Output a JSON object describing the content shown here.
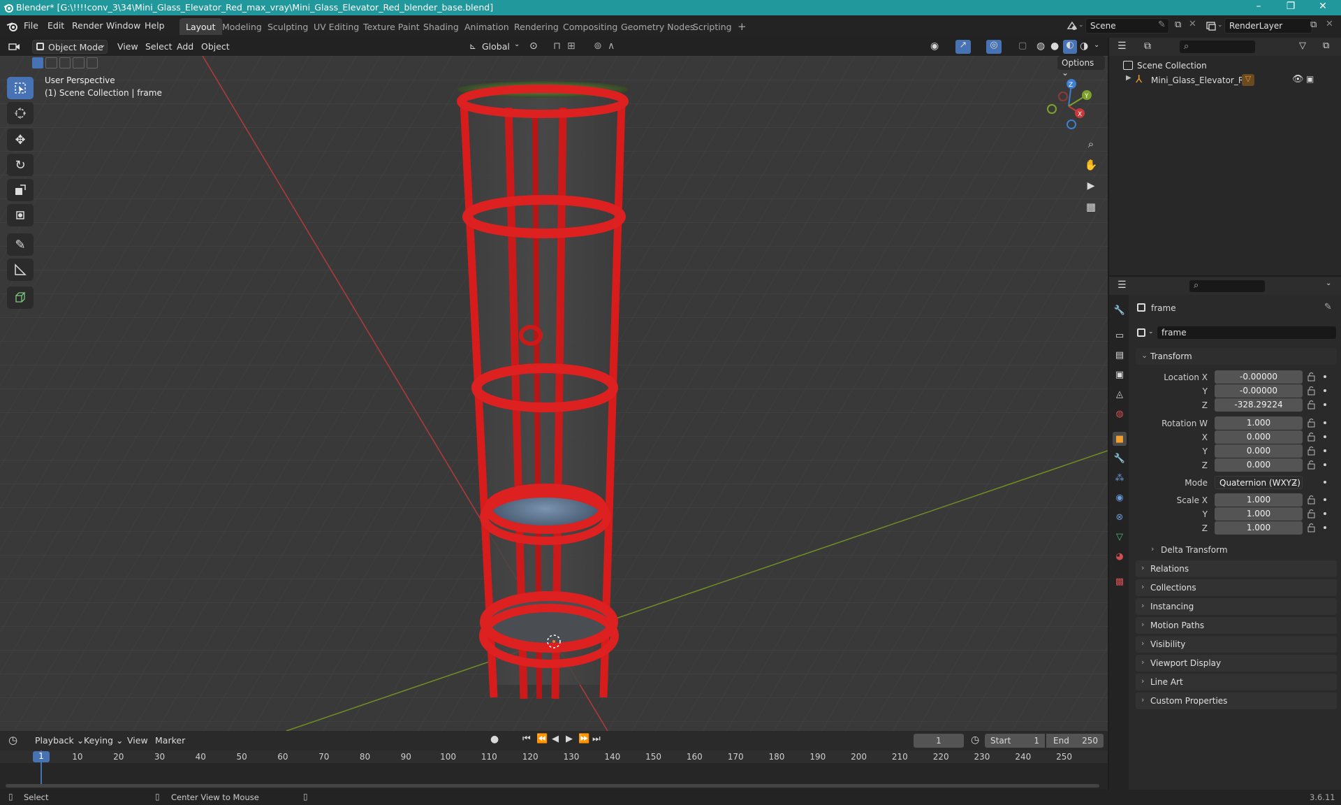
{
  "window": {
    "title": "Blender* [G:\\!!!!conv_3\\34\\Mini_Glass_Elevator_Red_max_vray\\Mini_Glass_Elevator_Red_blender_base.blend]",
    "controls": [
      "–",
      "❐",
      "✕"
    ]
  },
  "menu": {
    "items": [
      "File",
      "Edit",
      "Render",
      "Window",
      "Help"
    ],
    "workspaces": [
      "Layout",
      "Modeling",
      "Sculpting",
      "UV Editing",
      "Texture Paint",
      "Shading",
      "Animation",
      "Rendering",
      "Compositing",
      "Geometry Nodes",
      "Scripting"
    ],
    "active_workspace": "Layout",
    "add_tab": "+",
    "scene": "Scene",
    "render_layer": "RenderLayer"
  },
  "viewport_header": {
    "mode": "Object Mode",
    "menus": [
      "View",
      "Select",
      "Add",
      "Object"
    ],
    "orientation": "Global",
    "options_label": "Options"
  },
  "viewport": {
    "perspective": "User Perspective",
    "collection_info": "(1) Scene Collection | frame",
    "gizmo_axes": [
      "X",
      "Y",
      "Z"
    ]
  },
  "outliner": {
    "root": "Scene Collection",
    "items": [
      {
        "label": "Mini_Glass_Elevator_Red"
      }
    ]
  },
  "properties": {
    "object_name": "frame",
    "data_name": "frame",
    "transform_title": "Transform",
    "location": {
      "label": "Location X",
      "x": "-0.00000",
      "y": "-0.00000",
      "z": "-328.29224"
    },
    "rotation": {
      "label": "Rotation W",
      "w": "1.000",
      "x": "0.000",
      "y": "0.000",
      "z": "0.000"
    },
    "mode": {
      "label": "Mode",
      "value": "Quaternion (WXYZ)"
    },
    "scale": {
      "label": "Scale X",
      "x": "1.000",
      "y": "1.000",
      "z": "1.000"
    },
    "axis_labels": {
      "x": "X",
      "y": "Y",
      "z": "Z"
    },
    "delta_transform": "Delta Transform",
    "panels": [
      "Relations",
      "Collections",
      "Instancing",
      "Motion Paths",
      "Visibility",
      "Viewport Display",
      "Line Art",
      "Custom Properties"
    ]
  },
  "timeline": {
    "menus": [
      "Playback",
      "Keying",
      "View",
      "Marker"
    ],
    "current_frame": "1",
    "start_label": "Start",
    "start": "1",
    "end_label": "End",
    "end": "250",
    "ruler": [
      "1",
      "10",
      "20",
      "30",
      "40",
      "50",
      "60",
      "70",
      "80",
      "90",
      "100",
      "110",
      "120",
      "130",
      "140",
      "150",
      "160",
      "170",
      "180",
      "190",
      "200",
      "210",
      "220",
      "230",
      "240",
      "250"
    ]
  },
  "status": {
    "select": "Select",
    "center_view": "Center View to Mouse",
    "version": "3.6.11"
  },
  "colors": {
    "title_bar": "#20989c",
    "accent": "#4772b3",
    "frame_red": "#d81c1c",
    "x_axis": "#c83a3a",
    "y_axis": "#7ea12c",
    "z_axis": "#3d7fd1"
  }
}
